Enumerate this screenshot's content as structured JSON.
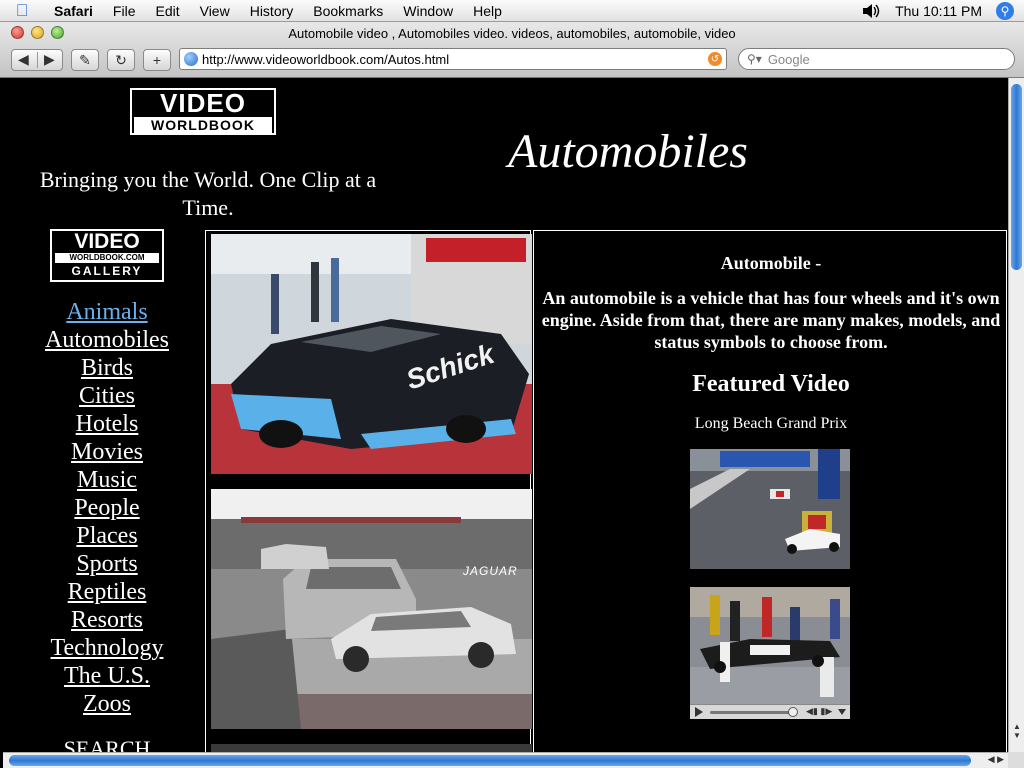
{
  "menubar": {
    "app_name": "Safari",
    "items": [
      "File",
      "Edit",
      "View",
      "History",
      "Bookmarks",
      "Window",
      "Help"
    ],
    "clock": "Thu 10:11 PM"
  },
  "window": {
    "title": "Automobile video , Automobiles video. videos, automobiles, automobile, video",
    "url": "http://www.videoworldbook.com/Autos.html",
    "search_placeholder": "Google"
  },
  "page": {
    "logo": {
      "line1": "VIDEO",
      "line2": "WORLDBOOK"
    },
    "tagline": "Bringing you the World. One Clip at a Time.",
    "heading": "Automobiles",
    "gallery_logo": {
      "line1": "VIDEO",
      "line2": "WORLDBOOK.COM",
      "line3": "GALLERY"
    },
    "nav": [
      "Animals",
      "Automobiles",
      "Birds",
      "Cities",
      "Hotels",
      "Movies",
      "Music ",
      "People",
      "Places",
      "Sports",
      "Reptiles",
      "Resorts",
      "Technology",
      "The U.S.",
      "Zoos"
    ],
    "nav_active": "Animals",
    "search_label": "SEARCH",
    "photos": [
      {
        "overlay": "Schick"
      },
      {
        "overlay": "JAGUAR"
      }
    ],
    "info": {
      "title": "Automobile -",
      "description": "An automobile is a vehicle that has four wheels and it's own engine. Aside from that, there are many makes, models, and status symbols to choose from.",
      "featured_heading": "Featured Video",
      "featured_caption": "Long Beach Grand Prix"
    }
  },
  "colors": {
    "page_background": "#000000",
    "text": "#ffffff",
    "link_visited": "#6bb0e8",
    "scroll_thumb": "#2f78d4"
  }
}
